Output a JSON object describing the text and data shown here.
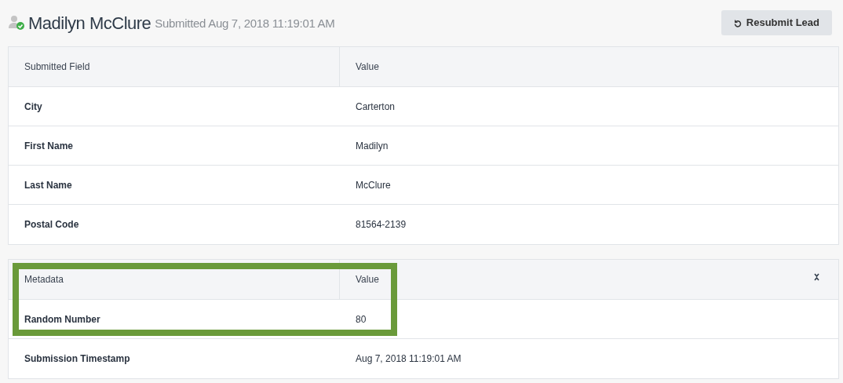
{
  "header": {
    "name": "Madilyn McClure",
    "submitted": "Submitted Aug 7, 2018 11:19:01 AM",
    "button": "Resubmit Lead"
  },
  "tables": [
    {
      "columns": [
        "Submitted Field",
        "Value"
      ],
      "collapsible": false,
      "highlighted": false,
      "rows": [
        {
          "field": "City",
          "value": "Carterton"
        },
        {
          "field": "First Name",
          "value": "Madilyn"
        },
        {
          "field": "Last Name",
          "value": "McClure"
        },
        {
          "field": "Postal Code",
          "value": "81564-2139"
        }
      ]
    },
    {
      "columns": [
        "Metadata",
        "Value"
      ],
      "collapsible": true,
      "highlighted": true,
      "rows": [
        {
          "field": "Random Number",
          "value": "80"
        },
        {
          "field": "Submission Timestamp",
          "value": "Aug 7, 2018 11:19:01 AM"
        }
      ]
    }
  ]
}
